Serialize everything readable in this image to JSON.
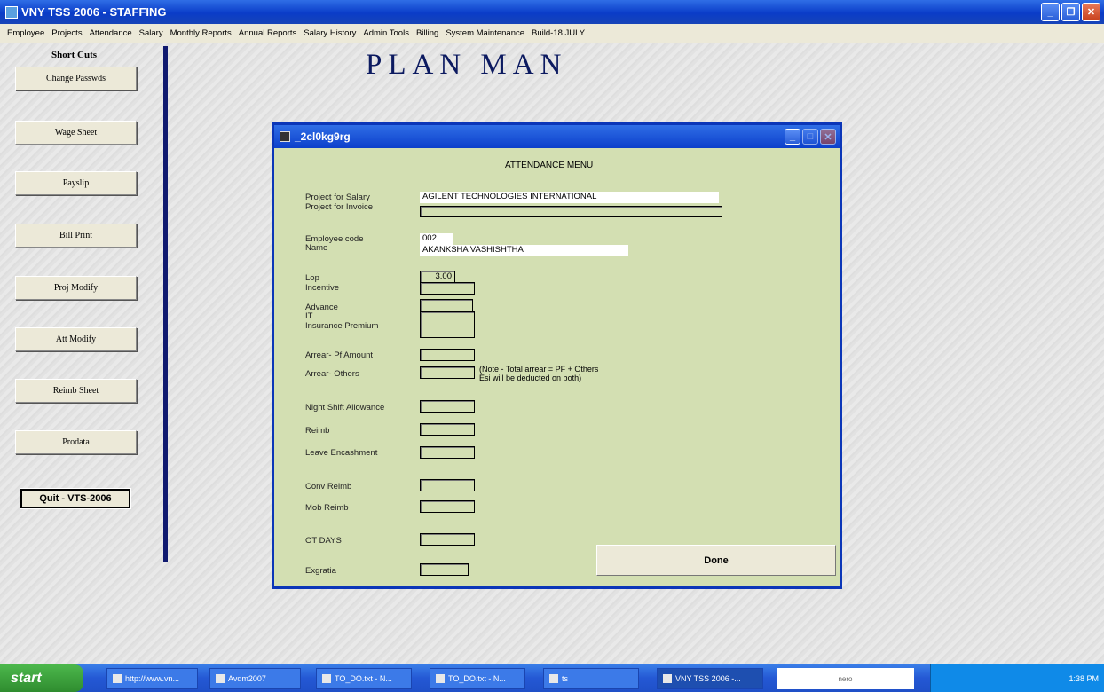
{
  "window": {
    "title": "VNY TSS 2006 - STAFFING"
  },
  "menu": [
    "Employee",
    "Projects",
    "Attendance",
    "Salary",
    "Monthly Reports",
    "Annual Reports",
    "Salary History",
    "Admin Tools",
    "Billing",
    "System Maintenance",
    "Build-18 JULY"
  ],
  "shortcuts": {
    "title": "Short Cuts",
    "buttons": [
      "Change Passwds",
      "Wage Sheet",
      "Payslip",
      "Bill Print",
      "Proj Modify",
      "Att Modify",
      "Reimb Sheet",
      "Prodata"
    ],
    "quit": "Quit - VTS-2006"
  },
  "page_title": "PLAN MAN",
  "dialog": {
    "title": "_2cl0kg9rg",
    "header": "ATTENDANCE MENU",
    "project_salary": {
      "label": "Project for Salary",
      "value": "AGILENT TECHNOLOGIES INTERNATIONAL"
    },
    "project_invoice": {
      "label": "Project for Invoice",
      "value": ""
    },
    "employee_code": {
      "label": "Employee code",
      "value": "002"
    },
    "name": {
      "label": "Name",
      "value": "AKANKSHA VASHISHTHA"
    },
    "lop": {
      "label": "Lop",
      "value": "3.00"
    },
    "incentive": {
      "label": "Incentive",
      "value": ""
    },
    "advance": {
      "label": "Advance",
      "value": ""
    },
    "it": {
      "label": "IT",
      "value": ""
    },
    "insurance": {
      "label": "Insurance Premium",
      "value": ""
    },
    "arrear_pf": {
      "label": "Arrear- Pf Amount",
      "value": ""
    },
    "arrear_others": {
      "label": "Arrear- Others",
      "value": ""
    },
    "note_line1": "(Note - Total arrear = PF + Others",
    "note_line2": "Esi will be deducted on both)",
    "night_shift": {
      "label": "Night Shift Allowance",
      "value": ""
    },
    "reimb": {
      "label": "Reimb",
      "value": ""
    },
    "leave_enc": {
      "label": "Leave Encashment",
      "value": ""
    },
    "conv_reimb": {
      "label": "Conv Reimb",
      "value": ""
    },
    "mob_reimb": {
      "label": "Mob Reimb",
      "value": ""
    },
    "ot_days": {
      "label": "OT DAYS",
      "value": ""
    },
    "exgratia": {
      "label": "Exgratia",
      "value": ""
    },
    "done": "Done"
  },
  "taskbar": {
    "start": "start",
    "items": [
      "http://www.vn...",
      "Avdm2007",
      "TO_DO.txt - N...",
      "TO_DO.txt - N...",
      "ts",
      "VNY TSS 2006 -..."
    ],
    "nero": "nero",
    "clock": "1:38 PM"
  }
}
